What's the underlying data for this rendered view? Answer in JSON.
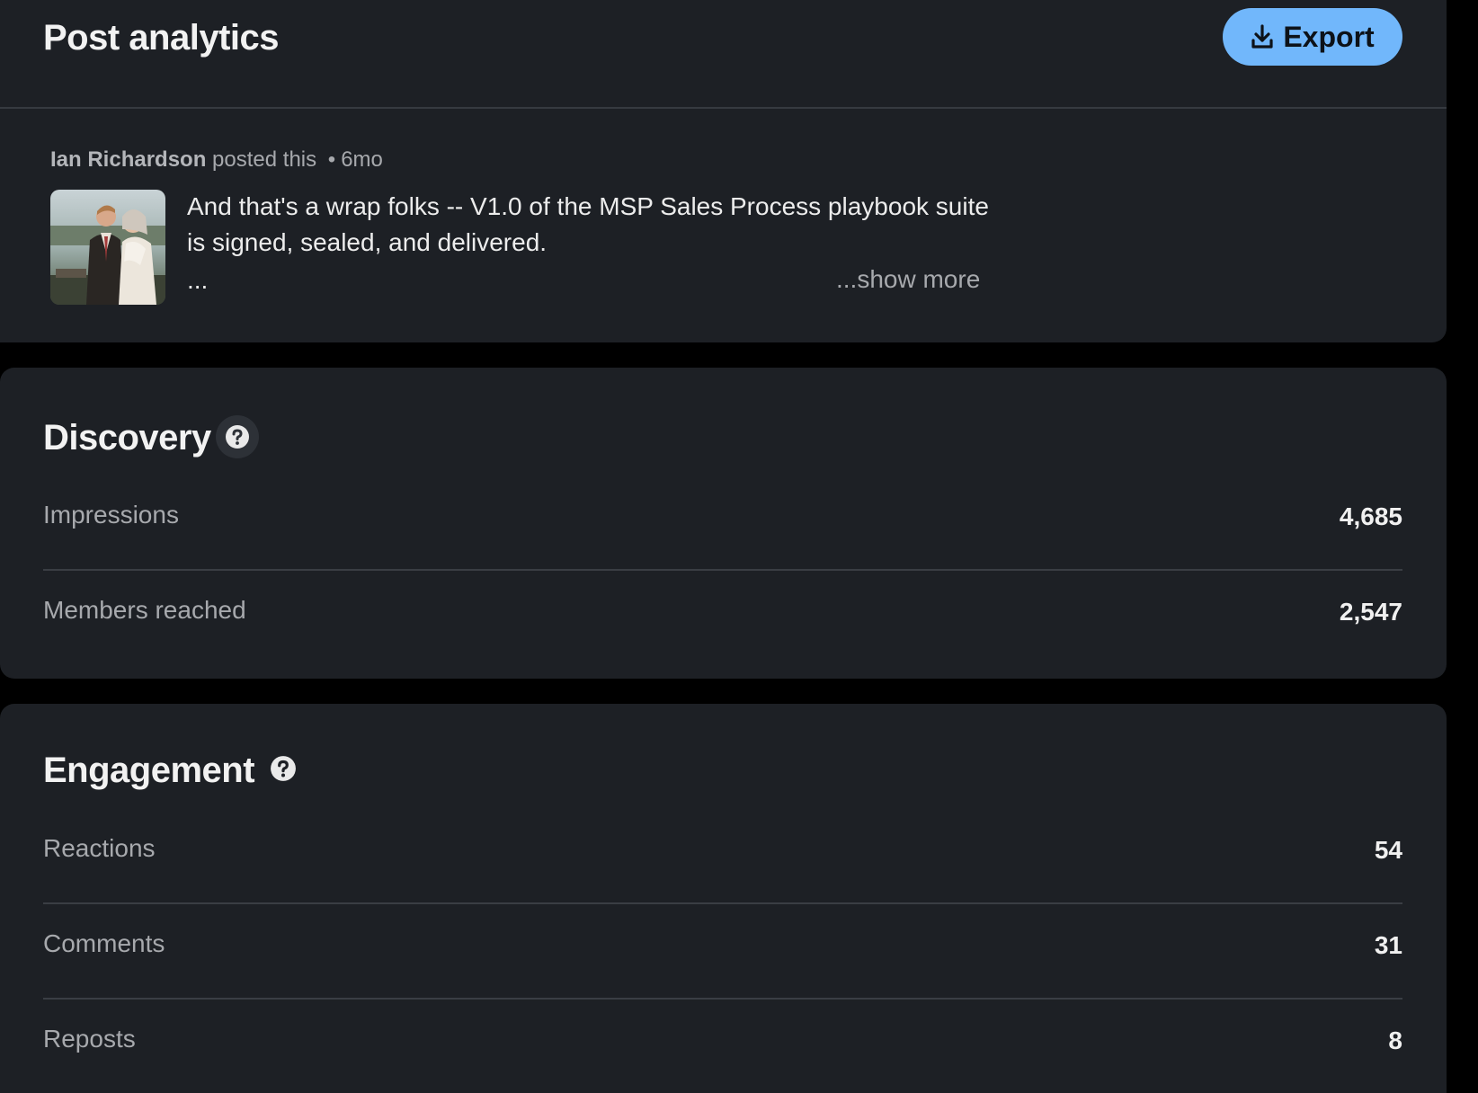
{
  "header": {
    "title": "Post analytics",
    "export_label": "Export",
    "export_icon": "download-icon"
  },
  "post": {
    "author": "Ian Richardson",
    "action": "posted this",
    "separator": "•",
    "age": "6mo",
    "text": "And that's a wrap folks -- V1.0 of the MSP Sales Process playbook suite is signed, sealed, and delivered.",
    "ellipsis": "...",
    "show_more": "...show more",
    "thumbnail": "post-photo"
  },
  "discovery": {
    "title": "Discovery",
    "help_icon": "question-circle-icon",
    "metrics": [
      {
        "label": "Impressions",
        "value": "4,685"
      },
      {
        "label": "Members reached",
        "value": "2,547"
      }
    ]
  },
  "engagement": {
    "title": "Engagement",
    "help_icon": "question-circle-icon",
    "metrics": [
      {
        "label": "Reactions",
        "value": "54"
      },
      {
        "label": "Comments",
        "value": "31"
      },
      {
        "label": "Reposts",
        "value": "8"
      }
    ]
  },
  "colors": {
    "background": "#000000",
    "card": "#1d2025",
    "accent": "#71b7fb",
    "muted_text": "#a7a9ad",
    "primary_text": "#f2f2f2",
    "divider": "#3a3e44"
  }
}
